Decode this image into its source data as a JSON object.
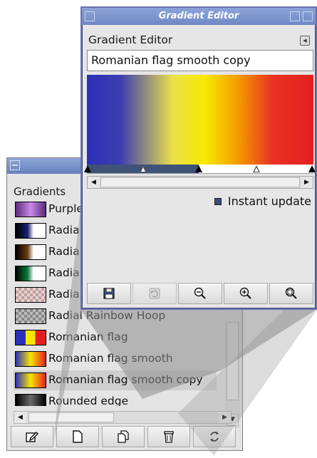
{
  "gradients_window": {
    "label": "Gradients",
    "items": [
      {
        "name": "Purple",
        "swatch": "linear-gradient(90deg,#5b2a7a,#c98ae8 50%,#5b2a7a)"
      },
      {
        "name": "Radial",
        "swatch": "linear-gradient(90deg,#000 0%,#1a1e6e 40%,#ffffff 60%)"
      },
      {
        "name": "Radial",
        "swatch": "linear-gradient(90deg,#000 0%,#6b3c10 40%,#ffffff 60%)"
      },
      {
        "name": "Radial",
        "swatch": "linear-gradient(90deg,#000 0%,#0b7a3a 40%,#ffffff 60%)"
      },
      {
        "name": "Radial",
        "swatch": "repeating-conic-gradient(#c0a0a0 0% 25%,#e8d0d0 0% 50%) 0 0/8px 8px"
      },
      {
        "name": "Radial Rainbow Hoop",
        "swatch": "repeating-conic-gradient(#888 0% 25%,#bbb 0% 50%) 0 0/8px 8px"
      },
      {
        "name": "Romanian flag",
        "swatch": "linear-gradient(90deg,#2a2fb8 0%,#2a2fb8 33%,#f7e600 33%,#f7e600 66%,#e31f1f 66%)"
      },
      {
        "name": "Romanian flag smooth",
        "swatch": "linear-gradient(90deg,#2a2fb8,#f7e600 50%,#e31f1f)"
      },
      {
        "name": "Romanian flag smooth copy",
        "swatch": "linear-gradient(90deg,#2a2fb8,#f7e600 50%,#e31f1f)"
      },
      {
        "name": "Rounded edge",
        "swatch": "linear-gradient(90deg,#000,#6a6a6a 50%,#000)"
      }
    ],
    "selected_index": 8,
    "toolbar_icons": [
      "edit-icon",
      "new-document-icon",
      "duplicate-icon",
      "delete-icon",
      "refresh-icon"
    ]
  },
  "gradient_editor": {
    "window_title": "Gradient Editor",
    "header": "Gradient Editor",
    "name_value": "Romanian flag smooth copy",
    "instant_update_label": "Instant update",
    "instant_update_checked": true,
    "toolbar_icons": [
      "save-icon",
      "revert-icon",
      "zoom-out-icon",
      "zoom-in-icon",
      "zoom-all-icon"
    ]
  },
  "colors": {
    "title_bar": "#7089c6",
    "selection_marker": "#3f5277"
  }
}
